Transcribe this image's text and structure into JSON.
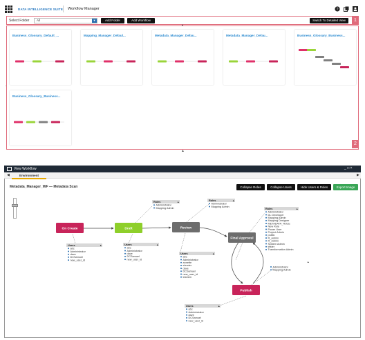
{
  "app": {
    "brand": "DATA INTELLIGENCE SUITE",
    "title": "Workflow Manager",
    "icons": [
      "apps-grid-icon",
      "help-icon",
      "copy-icon",
      "user-icon"
    ]
  },
  "toolbar": {
    "folder_label": "Select Folder",
    "folder_value": "All",
    "add_folder": "Add Folder",
    "add_workflow": "Add Workflow",
    "switch_view": "Switch To Detailed View",
    "badge_toolbar": "1",
    "badge_cards": "2"
  },
  "cards": [
    {
      "title": "Business_Glossary_Default_...",
      "stages": [
        "#e0306a",
        "#9ad43a",
        "#c8245a"
      ]
    },
    {
      "title": "Mapping_Manager_Defaul...",
      "stages": [
        "#9ad43a",
        "#e0306a",
        "#c8245a"
      ]
    },
    {
      "title": "Metadata_Manager_Defau...",
      "stages": [
        "#9ad43a",
        "#e0306a",
        "#c8245a"
      ]
    },
    {
      "title": "Metadata_Manager_Defau...",
      "stages": [
        "#9ad43a",
        "#e0306a",
        "#c8245a"
      ]
    },
    {
      "title": "Business_Glossary_Business...",
      "stages": [
        "#e0306a",
        "#9ad43a",
        "#808080",
        "#808080",
        "#808080",
        "#c8245a"
      ]
    },
    {
      "title": "Business_Glossary_Business...",
      "stages": [
        "#e0306a",
        "#9ad43a",
        "#808080",
        "#c8245a"
      ]
    }
  ],
  "dialog": {
    "title": "View Workflow",
    "tab": "Environment",
    "workflow_name": "Metadata_Manager_WF — Metadata Scan",
    "buttons": {
      "collapse_roles": "Collapse Roles",
      "collapse_users": "Collapse Users",
      "hide_users_roles": "Hide Users & Roles",
      "export_image": "Export Image"
    },
    "window_controls": "_ □ ×"
  },
  "workflow": {
    "colors": {
      "start": "#c8245a",
      "active": "#8ecf2a",
      "pending": "#6d6d6d",
      "end": "#c8245a"
    },
    "nodes": [
      {
        "id": "on_create",
        "label": "On Create"
      },
      {
        "id": "draft",
        "label": "Draft"
      },
      {
        "id": "review",
        "label": "Review"
      },
      {
        "id": "final_approval",
        "label": "Final Approval"
      },
      {
        "id": "publish",
        "label": "Publish"
      }
    ],
    "roles_title": "Roles",
    "users_title": "Users",
    "roles_draft": [
      "Administrator",
      "Mapping Admin"
    ],
    "roles_review": [
      "Administrator",
      "Mapping Admin"
    ],
    "roles_final": [
      "Administrator",
      "DL Developer",
      "Mapping Admin",
      "Mapping Designer",
      "METADATA_ROLE",
      "New Role",
      "Power User",
      "Project Admin",
      "public",
      "R_Admin",
      "R_Admin",
      "System Admin",
      "tester",
      "Transformation Admin"
    ],
    "roles_publish": [
      "Administrator",
      "Mapping Admin"
    ],
    "users_draft": [
      "abc",
      "Administrator",
      "dave",
      "DCSamuel",
      "new_user_id"
    ],
    "users_review": [
      "abc",
      "Administrator",
      "dave",
      "DCSamuel",
      "new_user_id"
    ],
    "users_final": [
      "abc",
      "Administrator",
      "annette",
      "elender",
      "dave",
      "DCSamuel",
      "new_user_id",
      "testrem"
    ],
    "users_publish": [
      "abc",
      "Administrator",
      "dave",
      "DCSamuel",
      "new_user_id"
    ]
  }
}
